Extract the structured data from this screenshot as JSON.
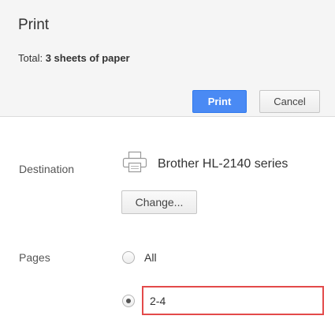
{
  "header": {
    "title": "Print",
    "total_prefix": "Total: ",
    "total_value": "3 sheets of paper",
    "print_label": "Print",
    "cancel_label": "Cancel"
  },
  "destination": {
    "label": "Destination",
    "printer_icon": "printer-icon",
    "printer_name": "Brother HL-2140 series",
    "change_label": "Change..."
  },
  "pages": {
    "label": "Pages",
    "option_all": "All",
    "selected": "custom",
    "custom_value": "2-4"
  },
  "colors": {
    "primary_button": "#4a8af4",
    "highlight_border": "#e34a4a",
    "header_bg": "#f5f5f5"
  }
}
